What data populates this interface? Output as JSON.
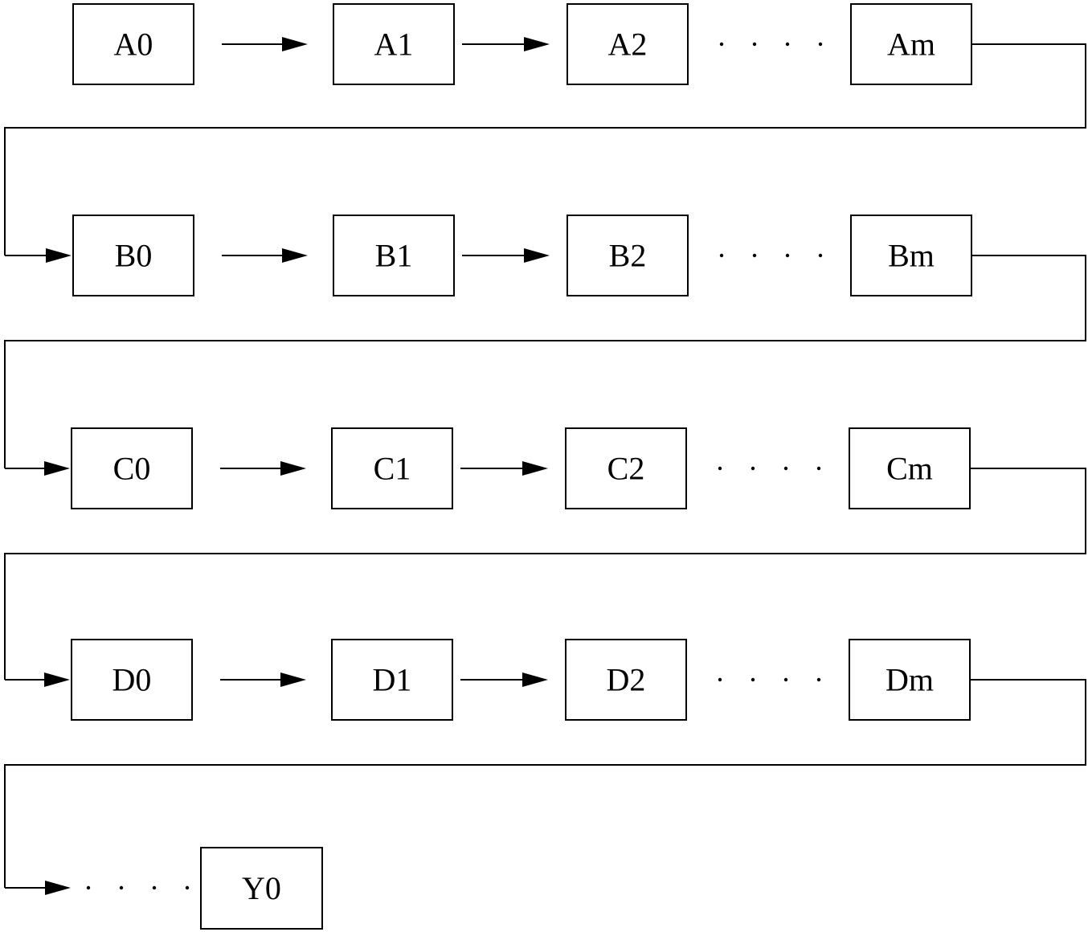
{
  "diagram": {
    "rows": [
      {
        "nodes": [
          "A0",
          "A1",
          "A2",
          "Am"
        ]
      },
      {
        "nodes": [
          "B0",
          "B1",
          "B2",
          "Bm"
        ]
      },
      {
        "nodes": [
          "C0",
          "C1",
          "C2",
          "Cm"
        ]
      },
      {
        "nodes": [
          "D0",
          "D1",
          "D2",
          "Dm"
        ]
      }
    ],
    "final_node": "Y0",
    "ellipsis": "· · · ·"
  }
}
